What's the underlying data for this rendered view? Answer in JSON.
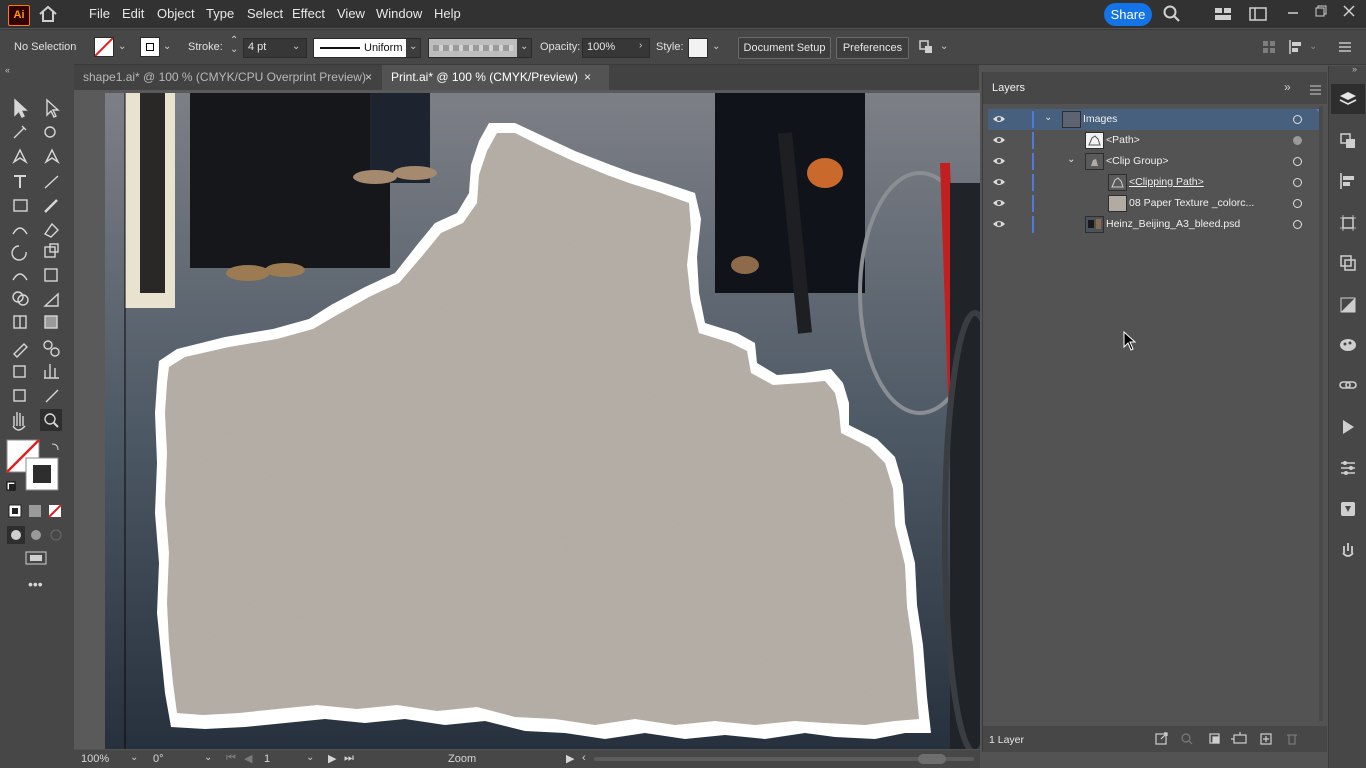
{
  "app": {
    "logo": "Ai",
    "menu": [
      "File",
      "Edit",
      "Object",
      "Type",
      "Select",
      "Effect",
      "View",
      "Window",
      "Help"
    ],
    "share_label": "Share"
  },
  "controlbar": {
    "selection": "No Selection",
    "stroke_label": "Stroke:",
    "stroke_weight": "4 pt",
    "stroke_profile": "Uniform",
    "opacity_label": "Opacity:",
    "opacity_value": "100%",
    "style_label": "Style:",
    "document_setup": "Document Setup",
    "preferences": "Preferences"
  },
  "tabs": [
    {
      "label": "shape1.ai* @ 100 % (CMYK/CPU Overprint Preview)",
      "active": false
    },
    {
      "label": "Print.ai* @ 100 % (CMYK/Preview)",
      "active": true
    }
  ],
  "statusbar": {
    "zoom": "100%",
    "rotation": "0°",
    "artboard": "1",
    "tool": "Zoom"
  },
  "layers_panel": {
    "title": "Layers",
    "rows": [
      {
        "name": "Images",
        "indent": 0,
        "expanded": true,
        "selected": true
      },
      {
        "name": "<Path>",
        "indent": 1
      },
      {
        "name": "<Clip Group>",
        "indent": 1,
        "expanded": true
      },
      {
        "name": "<Clipping Path>",
        "indent": 2,
        "underline": true
      },
      {
        "name": "08 Paper Texture _colorc...",
        "indent": 2
      },
      {
        "name": "Heinz_Beijing_A3_bleed.psd",
        "indent": 1
      }
    ],
    "footer": "1 Layer"
  },
  "colors": {
    "menubar": "#323232",
    "panel": "#474747",
    "workspace": "#535353",
    "accent": "#1473e6",
    "selected_row": "#46607d",
    "layer_color": "#4f7adb",
    "paper": "#b2aba3"
  },
  "icons": [
    "home-icon",
    "search-icon",
    "layout-icon",
    "layers-icon",
    "eye-icon",
    "chevron-down-icon",
    "close-icon",
    "menu-icon"
  ]
}
